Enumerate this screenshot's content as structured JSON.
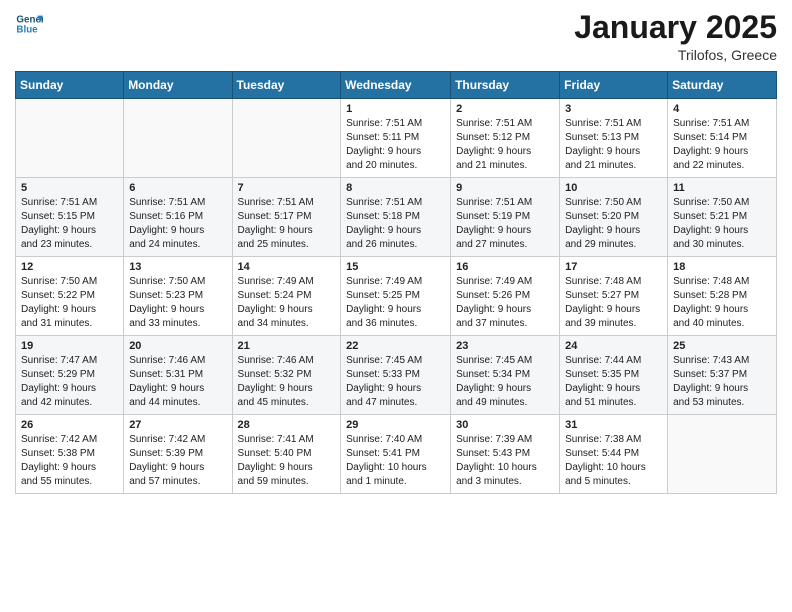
{
  "logo": {
    "line1": "General",
    "line2": "Blue"
  },
  "title": "January 2025",
  "subtitle": "Trilofos, Greece",
  "days_header": [
    "Sunday",
    "Monday",
    "Tuesday",
    "Wednesday",
    "Thursday",
    "Friday",
    "Saturday"
  ],
  "weeks": [
    [
      {
        "num": "",
        "info": ""
      },
      {
        "num": "",
        "info": ""
      },
      {
        "num": "",
        "info": ""
      },
      {
        "num": "1",
        "info": "Sunrise: 7:51 AM\nSunset: 5:11 PM\nDaylight: 9 hours\nand 20 minutes."
      },
      {
        "num": "2",
        "info": "Sunrise: 7:51 AM\nSunset: 5:12 PM\nDaylight: 9 hours\nand 21 minutes."
      },
      {
        "num": "3",
        "info": "Sunrise: 7:51 AM\nSunset: 5:13 PM\nDaylight: 9 hours\nand 21 minutes."
      },
      {
        "num": "4",
        "info": "Sunrise: 7:51 AM\nSunset: 5:14 PM\nDaylight: 9 hours\nand 22 minutes."
      }
    ],
    [
      {
        "num": "5",
        "info": "Sunrise: 7:51 AM\nSunset: 5:15 PM\nDaylight: 9 hours\nand 23 minutes."
      },
      {
        "num": "6",
        "info": "Sunrise: 7:51 AM\nSunset: 5:16 PM\nDaylight: 9 hours\nand 24 minutes."
      },
      {
        "num": "7",
        "info": "Sunrise: 7:51 AM\nSunset: 5:17 PM\nDaylight: 9 hours\nand 25 minutes."
      },
      {
        "num": "8",
        "info": "Sunrise: 7:51 AM\nSunset: 5:18 PM\nDaylight: 9 hours\nand 26 minutes."
      },
      {
        "num": "9",
        "info": "Sunrise: 7:51 AM\nSunset: 5:19 PM\nDaylight: 9 hours\nand 27 minutes."
      },
      {
        "num": "10",
        "info": "Sunrise: 7:50 AM\nSunset: 5:20 PM\nDaylight: 9 hours\nand 29 minutes."
      },
      {
        "num": "11",
        "info": "Sunrise: 7:50 AM\nSunset: 5:21 PM\nDaylight: 9 hours\nand 30 minutes."
      }
    ],
    [
      {
        "num": "12",
        "info": "Sunrise: 7:50 AM\nSunset: 5:22 PM\nDaylight: 9 hours\nand 31 minutes."
      },
      {
        "num": "13",
        "info": "Sunrise: 7:50 AM\nSunset: 5:23 PM\nDaylight: 9 hours\nand 33 minutes."
      },
      {
        "num": "14",
        "info": "Sunrise: 7:49 AM\nSunset: 5:24 PM\nDaylight: 9 hours\nand 34 minutes."
      },
      {
        "num": "15",
        "info": "Sunrise: 7:49 AM\nSunset: 5:25 PM\nDaylight: 9 hours\nand 36 minutes."
      },
      {
        "num": "16",
        "info": "Sunrise: 7:49 AM\nSunset: 5:26 PM\nDaylight: 9 hours\nand 37 minutes."
      },
      {
        "num": "17",
        "info": "Sunrise: 7:48 AM\nSunset: 5:27 PM\nDaylight: 9 hours\nand 39 minutes."
      },
      {
        "num": "18",
        "info": "Sunrise: 7:48 AM\nSunset: 5:28 PM\nDaylight: 9 hours\nand 40 minutes."
      }
    ],
    [
      {
        "num": "19",
        "info": "Sunrise: 7:47 AM\nSunset: 5:29 PM\nDaylight: 9 hours\nand 42 minutes."
      },
      {
        "num": "20",
        "info": "Sunrise: 7:46 AM\nSunset: 5:31 PM\nDaylight: 9 hours\nand 44 minutes."
      },
      {
        "num": "21",
        "info": "Sunrise: 7:46 AM\nSunset: 5:32 PM\nDaylight: 9 hours\nand 45 minutes."
      },
      {
        "num": "22",
        "info": "Sunrise: 7:45 AM\nSunset: 5:33 PM\nDaylight: 9 hours\nand 47 minutes."
      },
      {
        "num": "23",
        "info": "Sunrise: 7:45 AM\nSunset: 5:34 PM\nDaylight: 9 hours\nand 49 minutes."
      },
      {
        "num": "24",
        "info": "Sunrise: 7:44 AM\nSunset: 5:35 PM\nDaylight: 9 hours\nand 51 minutes."
      },
      {
        "num": "25",
        "info": "Sunrise: 7:43 AM\nSunset: 5:37 PM\nDaylight: 9 hours\nand 53 minutes."
      }
    ],
    [
      {
        "num": "26",
        "info": "Sunrise: 7:42 AM\nSunset: 5:38 PM\nDaylight: 9 hours\nand 55 minutes."
      },
      {
        "num": "27",
        "info": "Sunrise: 7:42 AM\nSunset: 5:39 PM\nDaylight: 9 hours\nand 57 minutes."
      },
      {
        "num": "28",
        "info": "Sunrise: 7:41 AM\nSunset: 5:40 PM\nDaylight: 9 hours\nand 59 minutes."
      },
      {
        "num": "29",
        "info": "Sunrise: 7:40 AM\nSunset: 5:41 PM\nDaylight: 10 hours\nand 1 minute."
      },
      {
        "num": "30",
        "info": "Sunrise: 7:39 AM\nSunset: 5:43 PM\nDaylight: 10 hours\nand 3 minutes."
      },
      {
        "num": "31",
        "info": "Sunrise: 7:38 AM\nSunset: 5:44 PM\nDaylight: 10 hours\nand 5 minutes."
      },
      {
        "num": "",
        "info": ""
      }
    ]
  ]
}
